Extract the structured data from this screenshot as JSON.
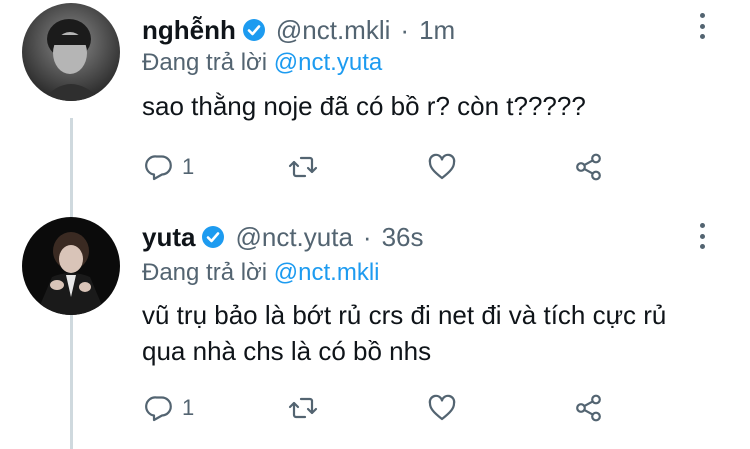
{
  "tweets": [
    {
      "name": "nghễnh",
      "handle": "@nct.mkli",
      "separator": "·",
      "time": "1m",
      "replying_prefix": "Đang trả lời",
      "replying_to": "@nct.yuta",
      "text": "sao thằng noje đã có bồ r? còn t?????",
      "reply_count": "1"
    },
    {
      "name": "yuta",
      "handle": "@nct.yuta",
      "separator": "·",
      "time": "36s",
      "replying_prefix": "Đang trả lời",
      "replying_to": "@nct.mkli",
      "text": "vũ trụ bảo là bớt rủ crs đi net đi và tích cực rủ qua nhà chs là có bồ nhs",
      "reply_count": "1"
    }
  ],
  "icons": {
    "verified": "verified-badge-icon",
    "more": "more-vertical-icon",
    "reply": "reply-icon",
    "retweet": "retweet-icon",
    "like": "heart-icon",
    "share": "share-icon"
  },
  "colors": {
    "accent": "#1d9bf0",
    "secondary_text": "#536471",
    "primary_text": "#0f1419",
    "thread_line": "#cfd9de"
  }
}
